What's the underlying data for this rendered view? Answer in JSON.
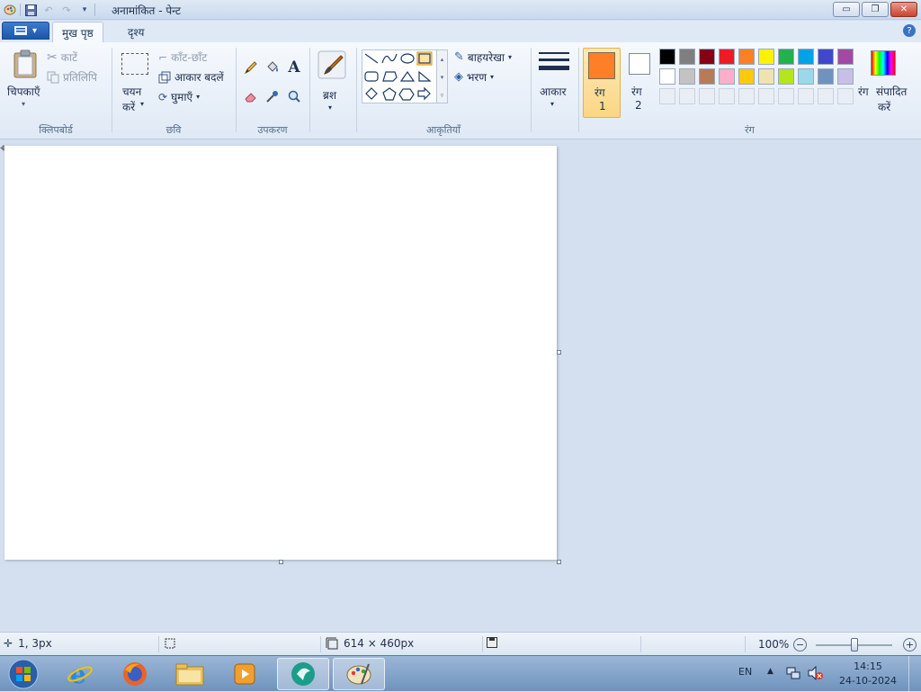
{
  "window": {
    "title": "अनामांकित - पेन्ट",
    "buttons": {
      "minimize": "▭",
      "restore": "❐",
      "close": "✕"
    }
  },
  "tabs": {
    "home": "मुख पृष्ठ",
    "view": "दृश्य"
  },
  "clipboard": {
    "paste": "चिपकाएँ",
    "cut": "काटें",
    "copy": "प्रतिलिपि",
    "group": "क्लिपबोर्ड"
  },
  "image": {
    "select_line1": "चयन",
    "select_line2": "करें",
    "crop": "काँट-छाँट",
    "resize": "आकार बदलें",
    "rotate": "घुमाएँ",
    "group": "छवि"
  },
  "tools": {
    "group": "उपकरण",
    "text_glyph": "A"
  },
  "brushes": {
    "label": "ब्रश"
  },
  "shapes": {
    "outline": "बाहयरेखा",
    "fill": "भरण",
    "group": "आकृतियाँ"
  },
  "size": {
    "label": "आकार"
  },
  "colors": {
    "color1_label": "रंग",
    "color1_num": "1",
    "color2_label": "रंग",
    "color2_num": "2",
    "edit_line1": "रंग",
    "edit_line2": "संपादित",
    "edit_line3": "करें",
    "group": "रंग",
    "color1": "#ff7f27",
    "color2": "#ffffff",
    "palette_row1": [
      "#000000",
      "#7f7f7f",
      "#880015",
      "#ed1c24",
      "#ff7f27",
      "#fff200",
      "#22b14c",
      "#00a2e8",
      "#3f48cc",
      "#a349a4"
    ],
    "palette_row2": [
      "#ffffff",
      "#c3c3c3",
      "#b97a57",
      "#ffaec9",
      "#ffc90e",
      "#efe4b0",
      "#b5e61d",
      "#99d9ea",
      "#7092be",
      "#c8bfe7"
    ]
  },
  "status": {
    "cursor_pos": "1, 3px",
    "canvas_size": "614 × 460px",
    "zoom": "100%"
  },
  "taskbar": {
    "lang": "EN",
    "time": "14:15",
    "date": "24-10-2024"
  }
}
